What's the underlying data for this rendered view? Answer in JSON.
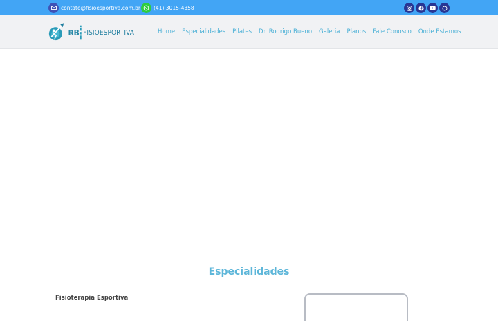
{
  "topbar": {
    "email": "contato@fisioesportiva.com.br",
    "phone": "(41) 3015-4358",
    "email_icon": "envelope-icon",
    "phone_icon": "whatsapp-icon",
    "socials": [
      {
        "name": "instagram-icon"
      },
      {
        "name": "facebook-icon"
      },
      {
        "name": "youtube-icon"
      },
      {
        "name": "whatsapp-icon"
      }
    ],
    "bg_color": "#42a5f5"
  },
  "logo": {
    "initials": "RB",
    "wordmark": "FISIOESPORTIVA"
  },
  "nav": {
    "items": [
      "Home",
      "Especialidades",
      "Pilates",
      "Dr. Rodrigo Bueno",
      "Galeria",
      "Planos",
      "Fale Conosco",
      "Onde Estamos"
    ],
    "color": "#4ab0d6"
  },
  "specialties": {
    "title": "Especialidades",
    "first_item": "Fisioterapia Esportiva",
    "title_color": "#5db6d9"
  }
}
